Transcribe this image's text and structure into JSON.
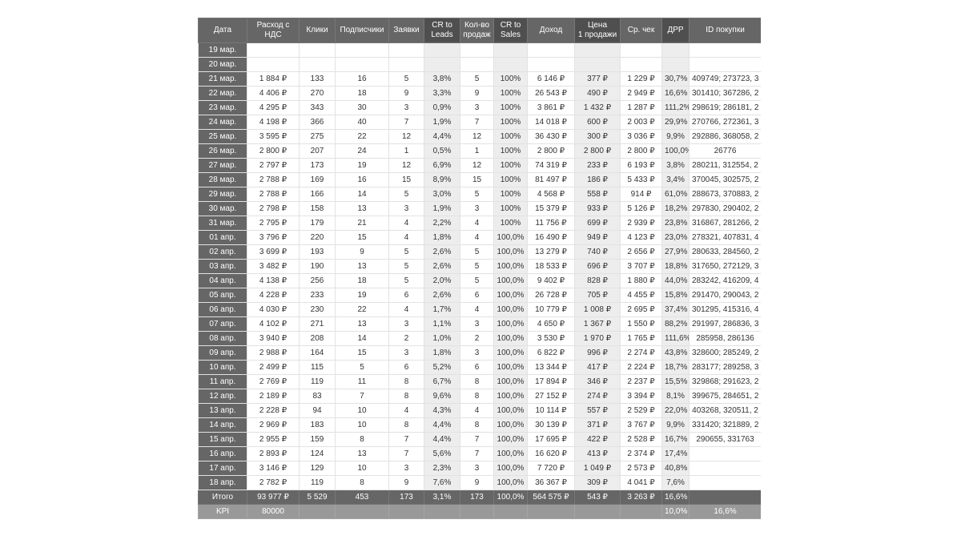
{
  "headers": [
    "Дата",
    "Расход с\nНДС",
    "Клики",
    "Подписчики",
    "Заявки",
    "CR to\nLeads",
    "Кол-во\nпродаж",
    "CR to\nSales",
    "Доход",
    "Цена\n1 продажи",
    "Ср. чек",
    "ДРР",
    "ID покупки"
  ],
  "rows": [
    [
      "19 мар.",
      "",
      "",
      "",
      "",
      "",
      "",
      "",
      "",
      "",
      "",
      "",
      ""
    ],
    [
      "20 мар.",
      "",
      "",
      "",
      "",
      "",
      "",
      "",
      "",
      "",
      "",
      "",
      ""
    ],
    [
      "21 мар.",
      "1 884 ₽",
      "133",
      "16",
      "5",
      "3,8%",
      "5",
      "100%",
      "6 146 ₽",
      "377 ₽",
      "1 229 ₽",
      "30,7%",
      "409749; 273723, 3"
    ],
    [
      "22 мар.",
      "4 406 ₽",
      "270",
      "18",
      "9",
      "3,3%",
      "9",
      "100%",
      "26 543 ₽",
      "490 ₽",
      "2 949 ₽",
      "16,6%",
      "301410; 367286, 2"
    ],
    [
      "23 мар.",
      "4 295 ₽",
      "343",
      "30",
      "3",
      "0,9%",
      "3",
      "100%",
      "3 861 ₽",
      "1 432 ₽",
      "1 287 ₽",
      "111,2%",
      "298619; 286181, 2"
    ],
    [
      "24 мар.",
      "4 198 ₽",
      "366",
      "40",
      "7",
      "1,9%",
      "7",
      "100%",
      "14 018 ₽",
      "600 ₽",
      "2 003 ₽",
      "29,9%",
      "270766, 272361, 3"
    ],
    [
      "25 мар.",
      "3 595 ₽",
      "275",
      "22",
      "12",
      "4,4%",
      "12",
      "100%",
      "36 430 ₽",
      "300 ₽",
      "3 036 ₽",
      "9,9%",
      "292886, 368058, 2"
    ],
    [
      "26 мар.",
      "2 800 ₽",
      "207",
      "24",
      "1",
      "0,5%",
      "1",
      "100%",
      "2 800 ₽",
      "2 800 ₽",
      "2 800 ₽",
      "100,0%",
      "26776"
    ],
    [
      "27 мар.",
      "2 797 ₽",
      "173",
      "19",
      "12",
      "6,9%",
      "12",
      "100%",
      "74 319 ₽",
      "233 ₽",
      "6 193 ₽",
      "3,8%",
      "280211, 312554, 2"
    ],
    [
      "28 мар.",
      "2 788 ₽",
      "169",
      "16",
      "15",
      "8,9%",
      "15",
      "100%",
      "81 497 ₽",
      "186 ₽",
      "5 433 ₽",
      "3,4%",
      "370045, 302575, 2"
    ],
    [
      "29 мар.",
      "2 788 ₽",
      "166",
      "14",
      "5",
      "3,0%",
      "5",
      "100%",
      "4 568 ₽",
      "558 ₽",
      "914 ₽",
      "61,0%",
      "288673, 370883, 2"
    ],
    [
      "30 мар.",
      "2 798 ₽",
      "158",
      "13",
      "3",
      "1,9%",
      "3",
      "100%",
      "15 379 ₽",
      "933 ₽",
      "5 126 ₽",
      "18,2%",
      "297830, 290402, 2"
    ],
    [
      "31 мар.",
      "2 795 ₽",
      "179",
      "21",
      "4",
      "2,2%",
      "4",
      "100%",
      "11 756 ₽",
      "699 ₽",
      "2 939 ₽",
      "23,8%",
      "316867, 281266, 2"
    ],
    [
      "01 апр.",
      "3 796 ₽",
      "220",
      "15",
      "4",
      "1,8%",
      "4",
      "100,0%",
      "16 490 ₽",
      "949 ₽",
      "4 123 ₽",
      "23,0%",
      "278321, 407831, 4"
    ],
    [
      "02 апр.",
      "3 699 ₽",
      "193",
      "9",
      "5",
      "2,6%",
      "5",
      "100,0%",
      "13 279 ₽",
      "740 ₽",
      "2 656 ₽",
      "27,9%",
      "280633, 284560, 2"
    ],
    [
      "03 апр.",
      "3 482 ₽",
      "190",
      "13",
      "5",
      "2,6%",
      "5",
      "100,0%",
      "18 533 ₽",
      "696 ₽",
      "3 707 ₽",
      "18,8%",
      "317650, 272129, 3"
    ],
    [
      "04 апр.",
      "4 138 ₽",
      "256",
      "18",
      "5",
      "2,0%",
      "5",
      "100,0%",
      "9 402 ₽",
      "828 ₽",
      "1 880 ₽",
      "44,0%",
      "283242, 416209, 4"
    ],
    [
      "05 апр.",
      "4 228 ₽",
      "233",
      "19",
      "6",
      "2,6%",
      "6",
      "100,0%",
      "26 728 ₽",
      "705 ₽",
      "4 455 ₽",
      "15,8%",
      "291470, 290043, 2"
    ],
    [
      "06 апр.",
      "4 030 ₽",
      "230",
      "22",
      "4",
      "1,7%",
      "4",
      "100,0%",
      "10 779 ₽",
      "1 008 ₽",
      "2 695 ₽",
      "37,4%",
      "301295, 415316, 4"
    ],
    [
      "07 апр.",
      "4 102 ₽",
      "271",
      "13",
      "3",
      "1,1%",
      "3",
      "100,0%",
      "4 650 ₽",
      "1 367 ₽",
      "1 550 ₽",
      "88,2%",
      "291997, 286836, 3"
    ],
    [
      "08 апр.",
      "3 940 ₽",
      "208",
      "14",
      "2",
      "1,0%",
      "2",
      "100,0%",
      "3 530 ₽",
      "1 970 ₽",
      "1 765 ₽",
      "111,6%",
      "285958, 286136"
    ],
    [
      "09 апр.",
      "2 988 ₽",
      "164",
      "15",
      "3",
      "1,8%",
      "3",
      "100,0%",
      "6 822 ₽",
      "996 ₽",
      "2 274 ₽",
      "43,8%",
      "328600; 285249, 2"
    ],
    [
      "10 апр.",
      "2 499 ₽",
      "115",
      "5",
      "6",
      "5,2%",
      "6",
      "100,0%",
      "13 344 ₽",
      "417 ₽",
      "2 224 ₽",
      "18,7%",
      "283177; 289258, 3"
    ],
    [
      "11 апр.",
      "2 769 ₽",
      "119",
      "11",
      "8",
      "6,7%",
      "8",
      "100,0%",
      "17 894 ₽",
      "346 ₽",
      "2 237 ₽",
      "15,5%",
      "329868; 291623, 2"
    ],
    [
      "12 апр.",
      "2 189 ₽",
      "83",
      "7",
      "8",
      "9,6%",
      "8",
      "100,0%",
      "27 152 ₽",
      "274 ₽",
      "3 394 ₽",
      "8,1%",
      "399675, 284651, 2"
    ],
    [
      "13 апр.",
      "2 228 ₽",
      "94",
      "10",
      "4",
      "4,3%",
      "4",
      "100,0%",
      "10 114 ₽",
      "557 ₽",
      "2 529 ₽",
      "22,0%",
      "403268, 320511, 2"
    ],
    [
      "14 апр.",
      "2 969 ₽",
      "183",
      "10",
      "8",
      "4,4%",
      "8",
      "100,0%",
      "30 139 ₽",
      "371 ₽",
      "3 767 ₽",
      "9,9%",
      "331420; 321889, 2"
    ],
    [
      "15 апр.",
      "2 955 ₽",
      "159",
      "8",
      "7",
      "4,4%",
      "7",
      "100,0%",
      "17 695 ₽",
      "422 ₽",
      "2 528 ₽",
      "16,7%",
      "290655, 331763"
    ],
    [
      "16 апр.",
      "2 893 ₽",
      "124",
      "13",
      "7",
      "5,6%",
      "7",
      "100,0%",
      "16 620 ₽",
      "413 ₽",
      "2 374 ₽",
      "17,4%",
      ""
    ],
    [
      "17 апр.",
      "3 146 ₽",
      "129",
      "10",
      "3",
      "2,3%",
      "3",
      "100,0%",
      "7 720 ₽",
      "1 049 ₽",
      "2 573 ₽",
      "40,8%",
      ""
    ],
    [
      "18 апр.",
      "2 782 ₽",
      "119",
      "8",
      "9",
      "7,6%",
      "9",
      "100,0%",
      "36 367 ₽",
      "309 ₽",
      "4 041 ₽",
      "7,6%",
      ""
    ]
  ],
  "total": [
    "Итого",
    "93 977 ₽",
    "5 529",
    "453",
    "173",
    "3,1%",
    "173",
    "100,0%",
    "564 575 ₽",
    "543 ₽",
    "3 263 ₽",
    "16,6%",
    ""
  ],
  "kpi": [
    "KPI",
    "80000",
    "",
    "",
    "",
    "",
    "",
    "",
    "",
    "",
    "",
    "10,0%",
    "16,6%"
  ]
}
